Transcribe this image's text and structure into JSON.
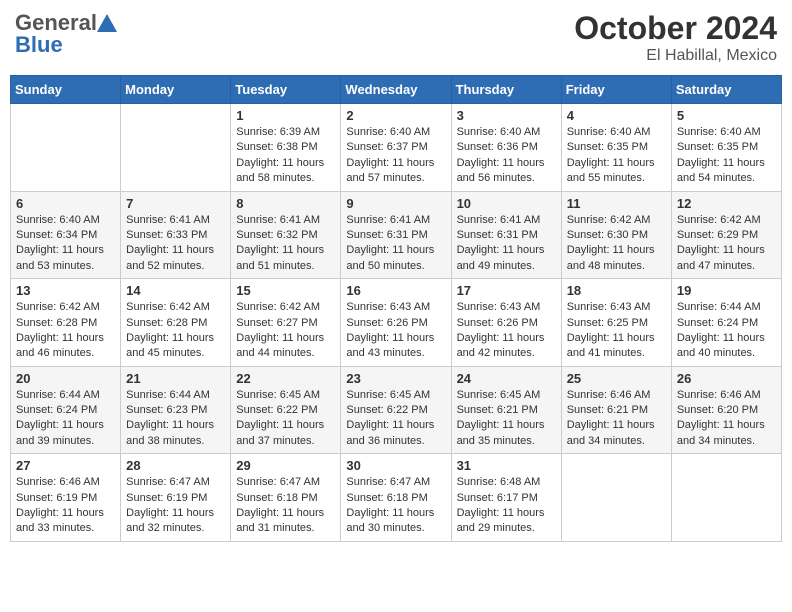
{
  "header": {
    "logo_general": "General",
    "logo_blue": "Blue",
    "month": "October 2024",
    "location": "El Habillal, Mexico"
  },
  "days_of_week": [
    "Sunday",
    "Monday",
    "Tuesday",
    "Wednesday",
    "Thursday",
    "Friday",
    "Saturday"
  ],
  "weeks": [
    [
      {
        "day": "",
        "info": ""
      },
      {
        "day": "",
        "info": ""
      },
      {
        "day": "1",
        "sunrise": "6:39 AM",
        "sunset": "6:38 PM",
        "daylight": "11 hours and 58 minutes."
      },
      {
        "day": "2",
        "sunrise": "6:40 AM",
        "sunset": "6:37 PM",
        "daylight": "11 hours and 57 minutes."
      },
      {
        "day": "3",
        "sunrise": "6:40 AM",
        "sunset": "6:36 PM",
        "daylight": "11 hours and 56 minutes."
      },
      {
        "day": "4",
        "sunrise": "6:40 AM",
        "sunset": "6:35 PM",
        "daylight": "11 hours and 55 minutes."
      },
      {
        "day": "5",
        "sunrise": "6:40 AM",
        "sunset": "6:35 PM",
        "daylight": "11 hours and 54 minutes."
      }
    ],
    [
      {
        "day": "6",
        "sunrise": "6:40 AM",
        "sunset": "6:34 PM",
        "daylight": "11 hours and 53 minutes."
      },
      {
        "day": "7",
        "sunrise": "6:41 AM",
        "sunset": "6:33 PM",
        "daylight": "11 hours and 52 minutes."
      },
      {
        "day": "8",
        "sunrise": "6:41 AM",
        "sunset": "6:32 PM",
        "daylight": "11 hours and 51 minutes."
      },
      {
        "day": "9",
        "sunrise": "6:41 AM",
        "sunset": "6:31 PM",
        "daylight": "11 hours and 50 minutes."
      },
      {
        "day": "10",
        "sunrise": "6:41 AM",
        "sunset": "6:31 PM",
        "daylight": "11 hours and 49 minutes."
      },
      {
        "day": "11",
        "sunrise": "6:42 AM",
        "sunset": "6:30 PM",
        "daylight": "11 hours and 48 minutes."
      },
      {
        "day": "12",
        "sunrise": "6:42 AM",
        "sunset": "6:29 PM",
        "daylight": "11 hours and 47 minutes."
      }
    ],
    [
      {
        "day": "13",
        "sunrise": "6:42 AM",
        "sunset": "6:28 PM",
        "daylight": "11 hours and 46 minutes."
      },
      {
        "day": "14",
        "sunrise": "6:42 AM",
        "sunset": "6:28 PM",
        "daylight": "11 hours and 45 minutes."
      },
      {
        "day": "15",
        "sunrise": "6:42 AM",
        "sunset": "6:27 PM",
        "daylight": "11 hours and 44 minutes."
      },
      {
        "day": "16",
        "sunrise": "6:43 AM",
        "sunset": "6:26 PM",
        "daylight": "11 hours and 43 minutes."
      },
      {
        "day": "17",
        "sunrise": "6:43 AM",
        "sunset": "6:26 PM",
        "daylight": "11 hours and 42 minutes."
      },
      {
        "day": "18",
        "sunrise": "6:43 AM",
        "sunset": "6:25 PM",
        "daylight": "11 hours and 41 minutes."
      },
      {
        "day": "19",
        "sunrise": "6:44 AM",
        "sunset": "6:24 PM",
        "daylight": "11 hours and 40 minutes."
      }
    ],
    [
      {
        "day": "20",
        "sunrise": "6:44 AM",
        "sunset": "6:24 PM",
        "daylight": "11 hours and 39 minutes."
      },
      {
        "day": "21",
        "sunrise": "6:44 AM",
        "sunset": "6:23 PM",
        "daylight": "11 hours and 38 minutes."
      },
      {
        "day": "22",
        "sunrise": "6:45 AM",
        "sunset": "6:22 PM",
        "daylight": "11 hours and 37 minutes."
      },
      {
        "day": "23",
        "sunrise": "6:45 AM",
        "sunset": "6:22 PM",
        "daylight": "11 hours and 36 minutes."
      },
      {
        "day": "24",
        "sunrise": "6:45 AM",
        "sunset": "6:21 PM",
        "daylight": "11 hours and 35 minutes."
      },
      {
        "day": "25",
        "sunrise": "6:46 AM",
        "sunset": "6:21 PM",
        "daylight": "11 hours and 34 minutes."
      },
      {
        "day": "26",
        "sunrise": "6:46 AM",
        "sunset": "6:20 PM",
        "daylight": "11 hours and 34 minutes."
      }
    ],
    [
      {
        "day": "27",
        "sunrise": "6:46 AM",
        "sunset": "6:19 PM",
        "daylight": "11 hours and 33 minutes."
      },
      {
        "day": "28",
        "sunrise": "6:47 AM",
        "sunset": "6:19 PM",
        "daylight": "11 hours and 32 minutes."
      },
      {
        "day": "29",
        "sunrise": "6:47 AM",
        "sunset": "6:18 PM",
        "daylight": "11 hours and 31 minutes."
      },
      {
        "day": "30",
        "sunrise": "6:47 AM",
        "sunset": "6:18 PM",
        "daylight": "11 hours and 30 minutes."
      },
      {
        "day": "31",
        "sunrise": "6:48 AM",
        "sunset": "6:17 PM",
        "daylight": "11 hours and 29 minutes."
      },
      {
        "day": "",
        "info": ""
      },
      {
        "day": "",
        "info": ""
      }
    ]
  ],
  "labels": {
    "sunrise": "Sunrise:",
    "sunset": "Sunset:",
    "daylight": "Daylight:"
  }
}
